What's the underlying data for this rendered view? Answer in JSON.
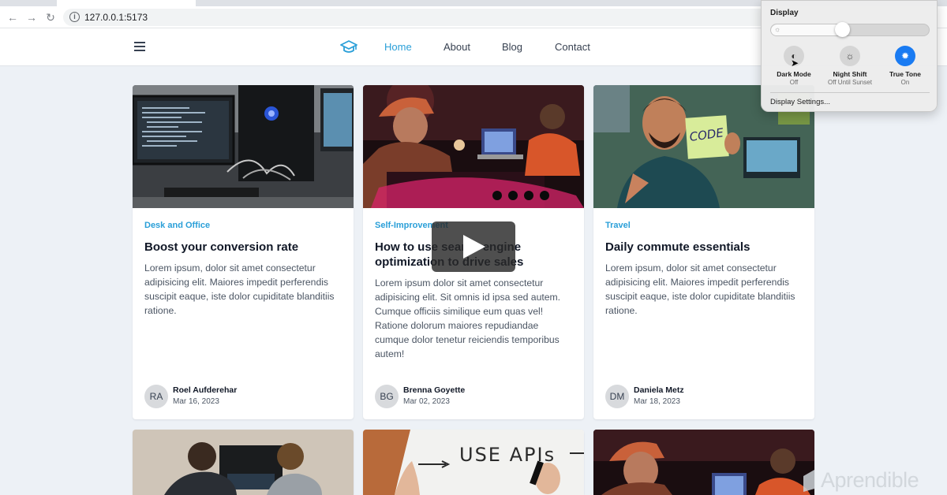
{
  "browser": {
    "url": "127.0.0.1:5173",
    "back_icon": "arrow-left-icon",
    "forward_icon": "arrow-right-icon",
    "reload_icon": "reload-icon"
  },
  "header": {
    "nav": [
      {
        "label": "Home",
        "active": true
      },
      {
        "label": "About",
        "active": false
      },
      {
        "label": "Blog",
        "active": false
      },
      {
        "label": "Contact",
        "active": false
      }
    ],
    "accent_color": "#2a9fd8"
  },
  "cards": [
    {
      "category": "Desk and Office",
      "title": "Boost your conversion rate",
      "excerpt": "Lorem ipsum, dolor sit amet consectetur adipisicing elit. Maiores impedit perferendis suscipit eaque, iste dolor cupiditate blanditiis ratione.",
      "initials": "RA",
      "author": "Roel Aufderehar",
      "date": "Mar 16, 2023"
    },
    {
      "category": "Self-Improvement",
      "title": "How to use search engine optimization to drive sales",
      "excerpt": "Lorem ipsum dolor sit amet consectetur adipisicing elit. Sit omnis id ipsa sed autem. Cumque officiis similique eum quas vel! Ratione dolorum maiores repudiandae cumque dolor tenetur reiciendis temporibus autem!",
      "initials": "BG",
      "author": "Brenna Goyette",
      "date": "Mar 02, 2023"
    },
    {
      "category": "Travel",
      "title": "Daily commute essentials",
      "excerpt": "Lorem ipsum, dolor sit amet consectetur adipisicing elit. Maiores impedit perferendis suscipit eaque, iste dolor cupiditate blanditiis ratione.",
      "initials": "DM",
      "author": "Daniela Metz",
      "date": "Mar 18, 2023"
    }
  ],
  "display_panel": {
    "title": "Display",
    "brightness": 0.45,
    "buttons": [
      {
        "label": "Dark Mode",
        "status": "Off",
        "icon": "dark-mode-icon",
        "on": false
      },
      {
        "label": "Night Shift",
        "status": "Off Until Sunset",
        "icon": "night-shift-icon",
        "on": false
      },
      {
        "label": "True Tone",
        "status": "On",
        "icon": "true-tone-icon",
        "on": true
      }
    ],
    "settings_link": "Display Settings..."
  },
  "watermark": "Aprendible"
}
